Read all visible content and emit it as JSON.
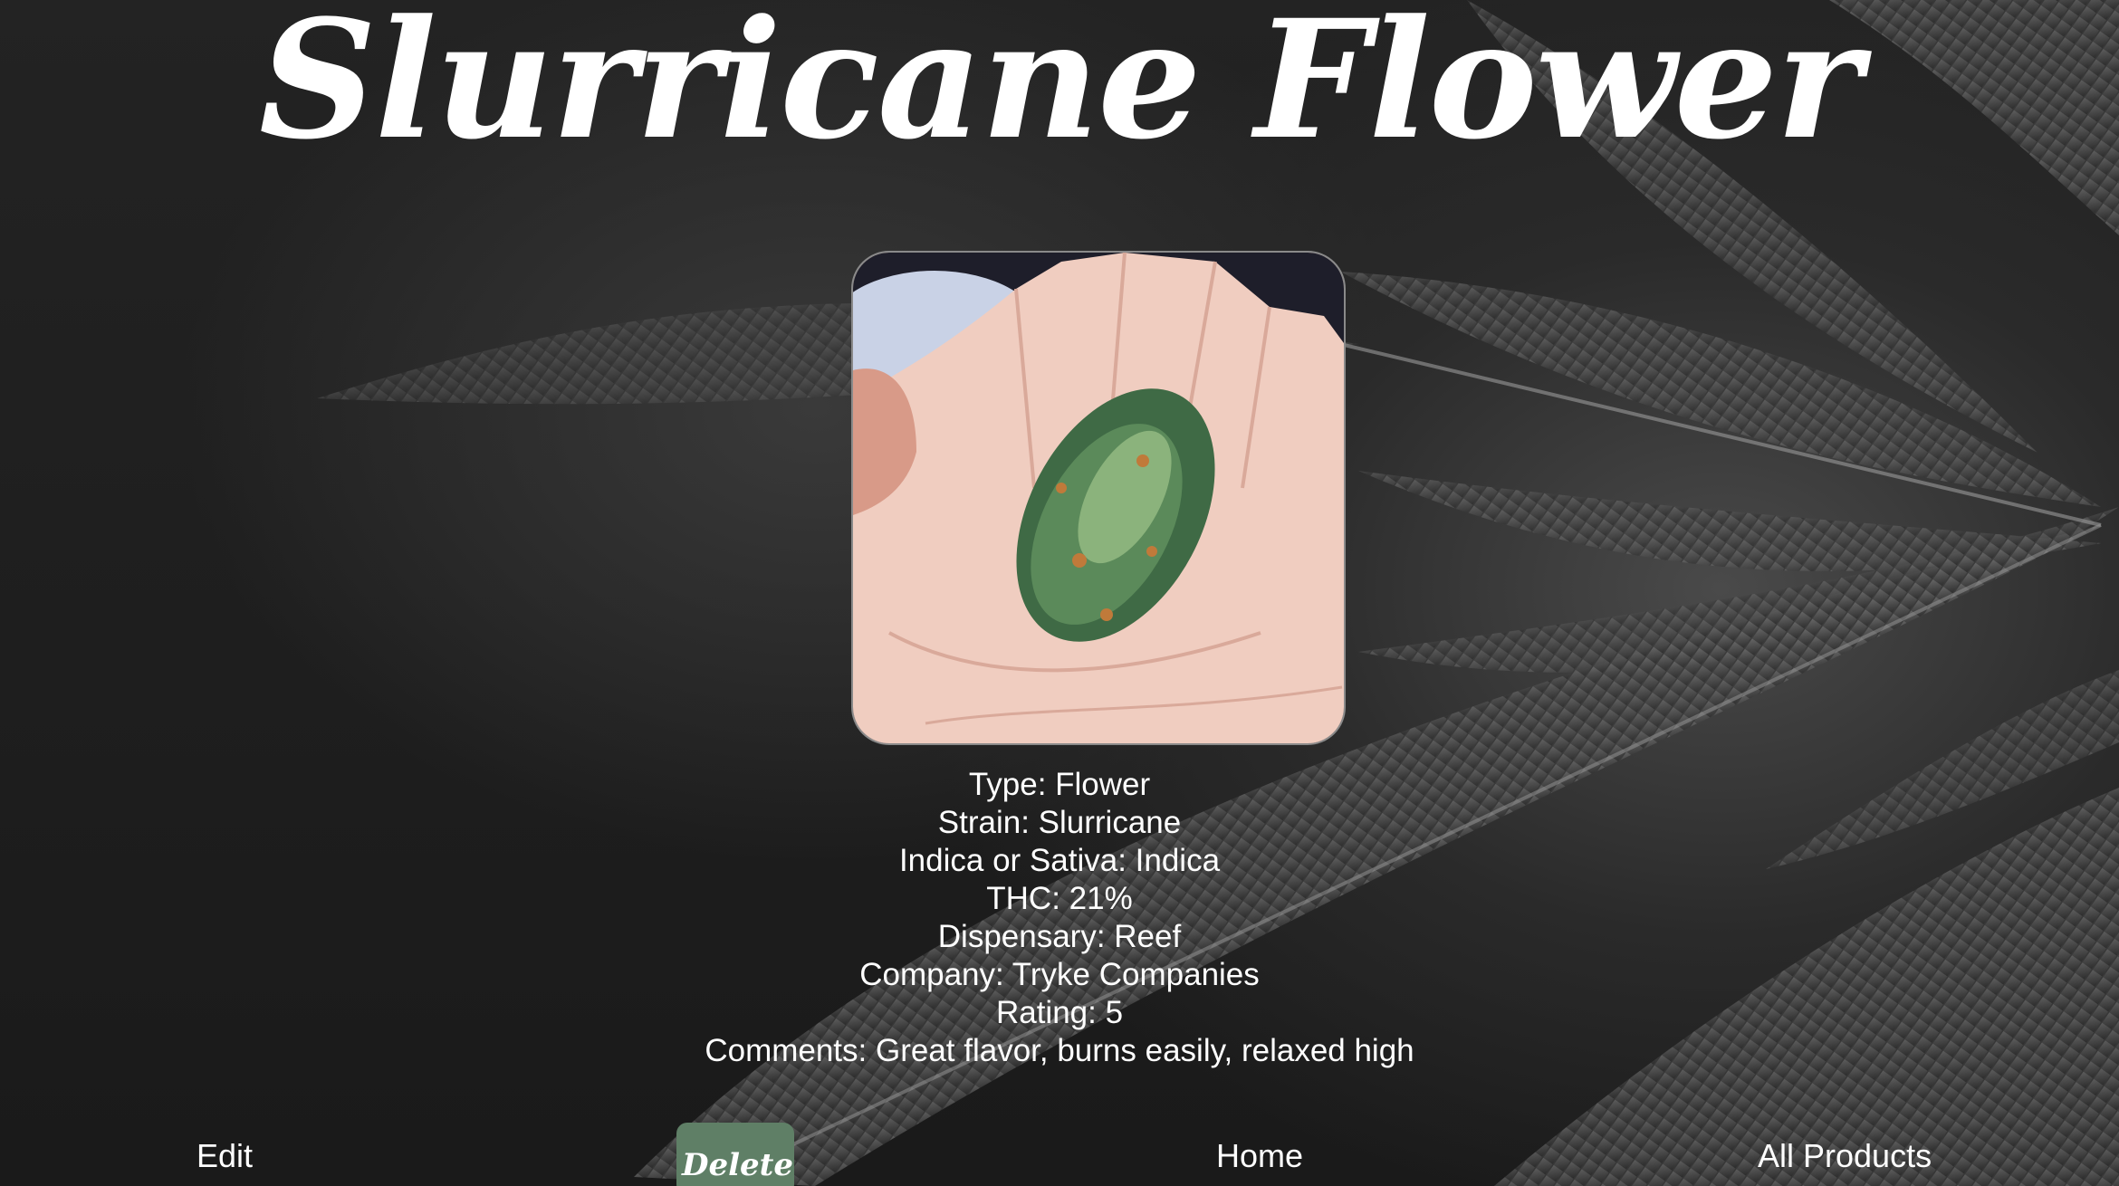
{
  "title": "Slurricane Flower",
  "photo": {
    "icon": "cannabis-bud-in-hand-photo"
  },
  "details": {
    "type": "Type: Flower",
    "strain": "Strain: Slurricane",
    "indica_or_sativa": "Indica or Sativa: Indica",
    "thc": "THC: 21%",
    "dispensary": "Dispensary: Reef",
    "company": "Company: Tryke Companies",
    "rating": "Rating: 5",
    "comments": "Comments: Great flavor, burns easily, relaxed high"
  },
  "nav": {
    "edit_label": "Edit",
    "delete_label": "Delete",
    "home_label": "Home",
    "all_products_label": "All Products"
  },
  "colors": {
    "background": "#1c1c1c",
    "delete_button": "#5f7f66",
    "text": "#ffffff"
  }
}
